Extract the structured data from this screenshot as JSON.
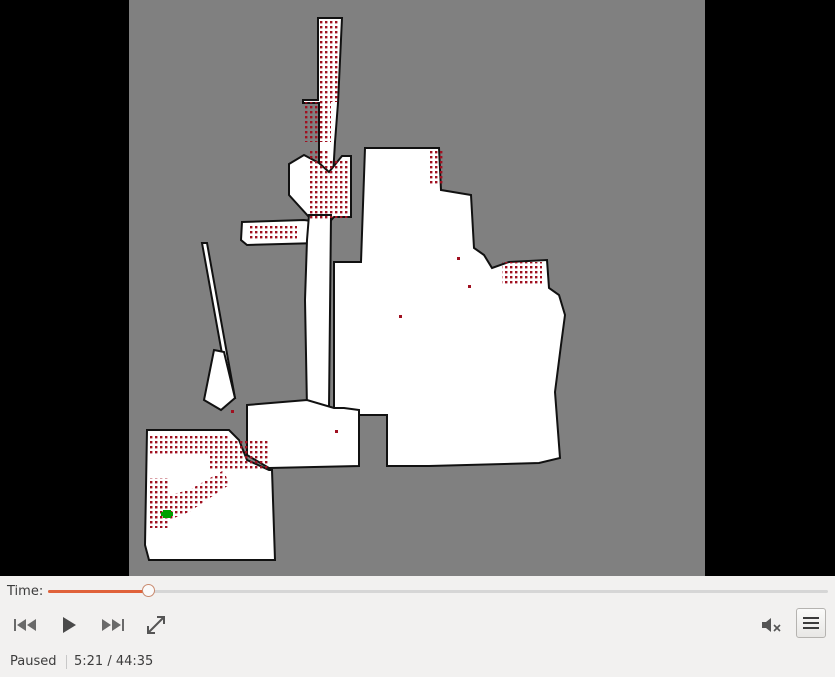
{
  "player": {
    "time_label": "Time:",
    "progress": 0.129,
    "status": "Paused",
    "position": "5:21",
    "duration": "44:35",
    "position_display": "5:21 / 44:35"
  },
  "icons": {
    "skip_back": "skip-back-icon",
    "play": "play-icon",
    "skip_forward": "skip-forward-icon",
    "fullscreen": "fullscreen-icon",
    "volume": "volume-muted-icon",
    "menu": "menu-icon"
  },
  "colors": {
    "accent": "#e0623a",
    "map_unknown": "#808080",
    "map_free": "#ffffff",
    "map_occupied": "#000000",
    "map_points": "#a01020",
    "robot": "#00a000"
  }
}
